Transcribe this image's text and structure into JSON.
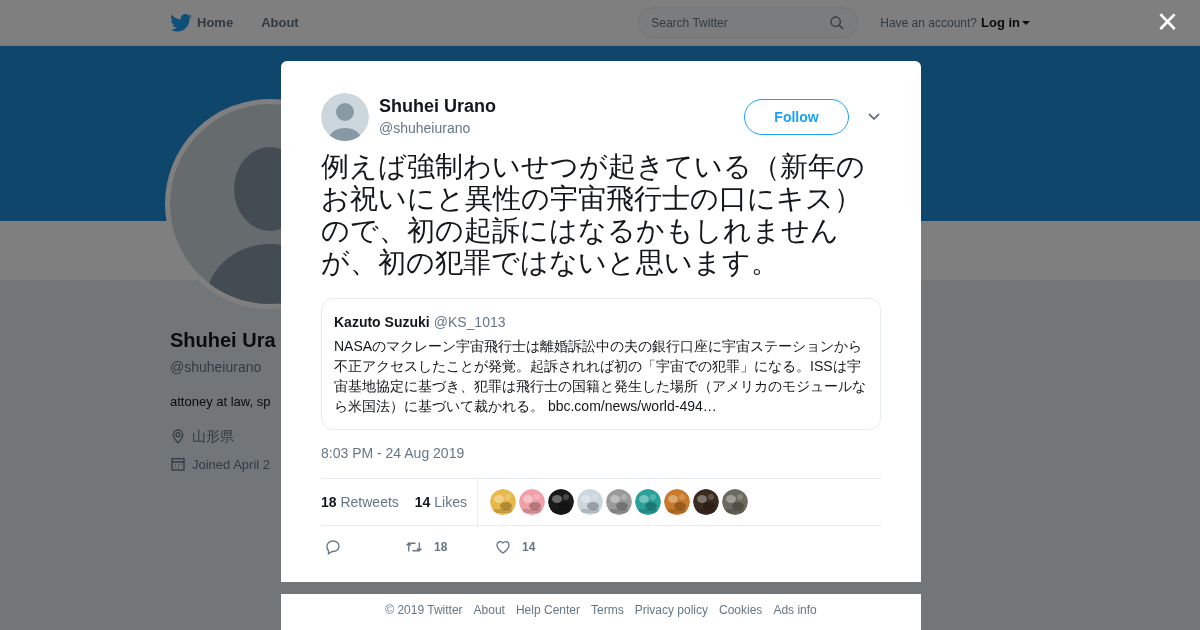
{
  "nav": {
    "items": [
      {
        "label": "Home"
      },
      {
        "label": "About"
      }
    ],
    "search": {
      "placeholder": "Search Twitter"
    },
    "account_prompt": "Have an account?",
    "login": "Log in"
  },
  "profile": {
    "name": "Shuhei Ura",
    "handle": "@shuheiurano",
    "bio": "attoney at law, sp",
    "location": "山形県",
    "joined": "Joined April 2"
  },
  "close": "×",
  "tweet": {
    "name": "Shuhei Urano",
    "handle": "@shuheiurano",
    "follow": "Follow",
    "text": "例えば強制わいせつが起きている（新年のお祝いにと異性の宇宙飛行士の口にキス）ので、初の起訴にはなるかもしれませんが、初の犯罪ではないと思います。",
    "quote": {
      "name": "Kazuto Suzuki",
      "handle": "@KS_1013",
      "text": "NASAのマクレーン宇宙飛行士は離婚訴訟中の夫の銀行口座に宇宙ステーションから不正アクセスしたことが発覚。起訴されれば初の「宇宙での犯罪」になる。ISSは宇宙基地協定に基づき、犯罪は飛行士の国籍と発生した場所（アメリカのモジュールなら米国法）に基づいて裁かれる。",
      "link": "bbc.com/news/world-494…"
    },
    "timestamp": "8:03 PM - 24 Aug 2019",
    "stats": [
      {
        "count": "18",
        "label": "Retweets"
      },
      {
        "count": "14",
        "label": "Likes"
      }
    ],
    "likers": [
      {
        "color": "#e8b84a"
      },
      {
        "color": "#f0a0a8"
      },
      {
        "color": "#1a1a1a"
      },
      {
        "color": "#ccd6dd"
      },
      {
        "color": "#9a9a9a"
      },
      {
        "color": "#2aa198"
      },
      {
        "color": "#c87a2a"
      },
      {
        "color": "#3a2a20"
      },
      {
        "color": "#6a6a60"
      }
    ],
    "actions": [
      {
        "kind": "reply"
      },
      {
        "kind": "retweet",
        "count": "18"
      },
      {
        "kind": "like",
        "count": "14"
      }
    ]
  },
  "footer": [
    "© 2019 Twitter",
    "About",
    "Help Center",
    "Terms",
    "Privacy policy",
    "Cookies",
    "Ads info"
  ]
}
